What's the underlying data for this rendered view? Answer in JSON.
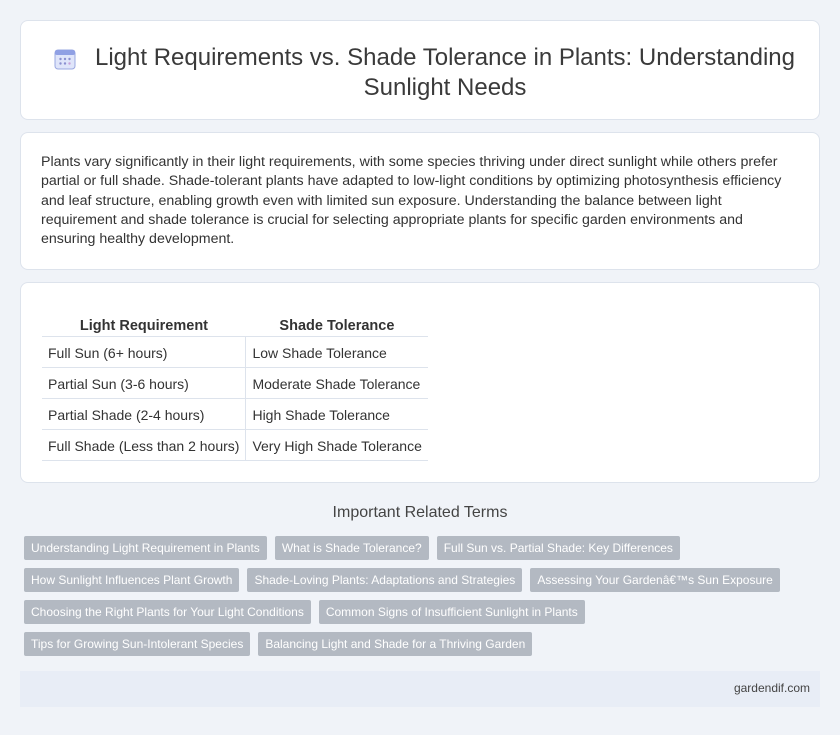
{
  "header": {
    "title": "Light Requirements vs. Shade Tolerance in Plants: Understanding Sunlight Needs",
    "icon": "calendar-icon"
  },
  "intro": {
    "text": "Plants vary significantly in their light requirements, with some species thriving under direct sunlight while others prefer partial or full shade. Shade-tolerant plants have adapted to low-light conditions by optimizing photosynthesis efficiency and leaf structure, enabling growth even with limited sun exposure. Understanding the balance between light requirement and shade tolerance is crucial for selecting appropriate plants for specific garden environments and ensuring healthy development."
  },
  "table": {
    "headers": [
      "Light Requirement",
      "Shade Tolerance"
    ],
    "rows": [
      [
        "Full Sun (6+ hours)",
        "Low Shade Tolerance"
      ],
      [
        "Partial Sun (3-6 hours)",
        "Moderate Shade Tolerance"
      ],
      [
        "Partial Shade (2-4 hours)",
        "High Shade Tolerance"
      ],
      [
        "Full Shade (Less than 2 hours)",
        "Very High Shade Tolerance"
      ]
    ]
  },
  "related": {
    "title": "Important Related Terms",
    "rows": [
      [
        "Understanding Light Requirement in Plants",
        "What is Shade Tolerance?",
        "Full Sun vs. Partial Shade: Key Differences"
      ],
      [
        "How Sunlight Influences Plant Growth",
        "Shade-Loving Plants: Adaptations and Strategies",
        "Assessing Your Gardenâ€™s Sun Exposure"
      ],
      [
        "Choosing the Right Plants for Your Light Conditions",
        "Common Signs of Insufficient Sunlight in Plants"
      ],
      [
        "Tips for Growing Sun-Intolerant Species",
        "Balancing Light and Shade for a Thriving Garden"
      ]
    ]
  },
  "footer": {
    "site": "gardendif.com"
  },
  "colors": {
    "background": "#f0f3f8",
    "tag": "#b3b9c2",
    "footer": "#e8edf6",
    "icon_accent": "#7b8fd6"
  }
}
